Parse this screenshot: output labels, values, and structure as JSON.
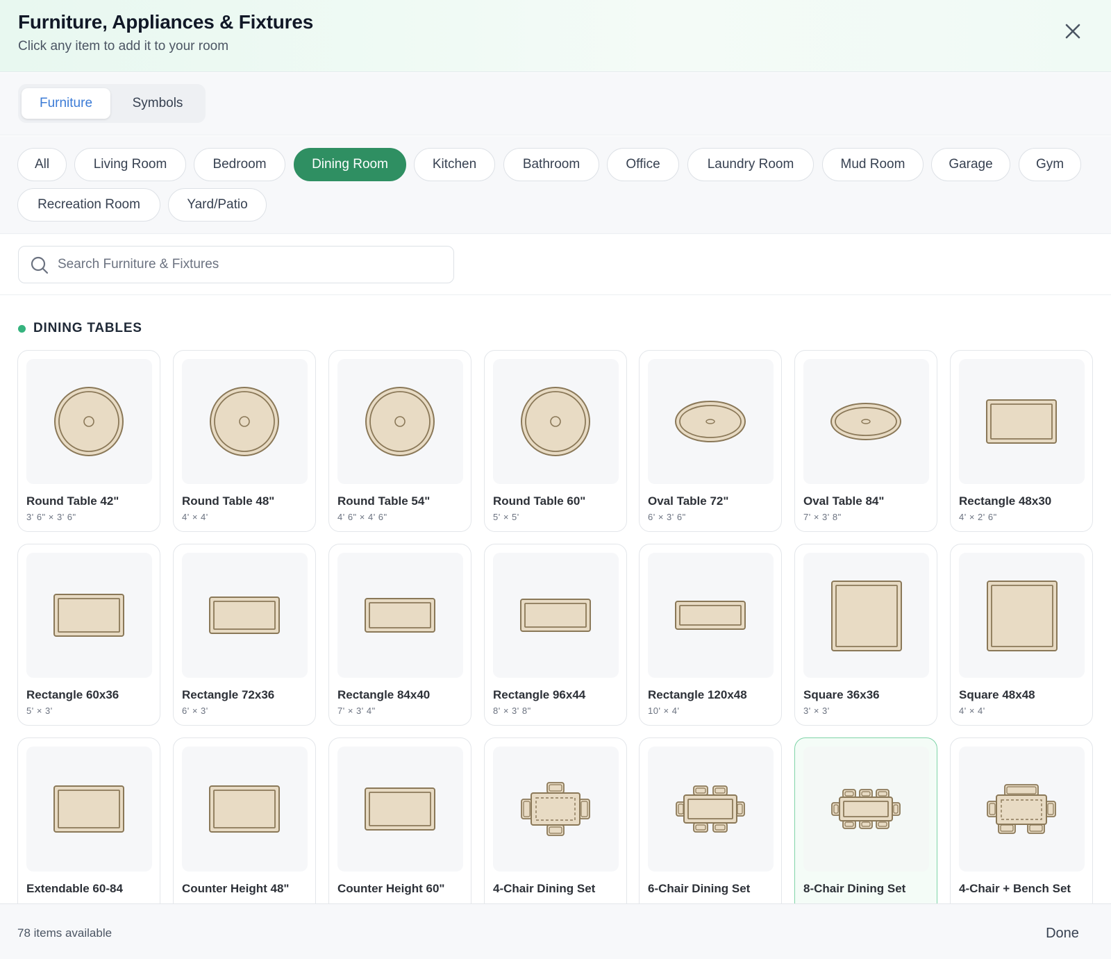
{
  "header": {
    "title": "Furniture, Appliances & Fixtures",
    "subtitle": "Click any item to add it to your room",
    "close_icon": "close-icon"
  },
  "tabs": [
    {
      "label": "Furniture",
      "active": true
    },
    {
      "label": "Symbols",
      "active": false
    }
  ],
  "categories": [
    {
      "label": "All",
      "active": false
    },
    {
      "label": "Living Room",
      "active": false
    },
    {
      "label": "Bedroom",
      "active": false
    },
    {
      "label": "Dining Room",
      "active": true
    },
    {
      "label": "Kitchen",
      "active": false
    },
    {
      "label": "Bathroom",
      "active": false
    },
    {
      "label": "Office",
      "active": false
    },
    {
      "label": "Laundry Room",
      "active": false
    },
    {
      "label": "Mud Room",
      "active": false
    },
    {
      "label": "Garage",
      "active": false
    },
    {
      "label": "Gym",
      "active": false
    },
    {
      "label": "Recreation Room",
      "active": false
    },
    {
      "label": "Yard/Patio",
      "active": false
    }
  ],
  "search": {
    "placeholder": "Search Furniture & Fixtures",
    "value": ""
  },
  "section": {
    "title": "DINING TABLES"
  },
  "items": [
    {
      "name": "Round Table 42\"",
      "dims": "3' 6\" × 3' 6\"",
      "icon": "round-table-icon"
    },
    {
      "name": "Round Table 48\"",
      "dims": "4' × 4'",
      "icon": "round-table-icon"
    },
    {
      "name": "Round Table 54\"",
      "dims": "4' 6\" × 4' 6\"",
      "icon": "round-table-icon"
    },
    {
      "name": "Round Table 60\"",
      "dims": "5' × 5'",
      "icon": "round-table-icon"
    },
    {
      "name": "Oval Table 72\"",
      "dims": "6' × 3' 6\"",
      "icon": "oval-table-icon"
    },
    {
      "name": "Oval Table 84\"",
      "dims": "7' × 3' 8\"",
      "icon": "oval-table-icon"
    },
    {
      "name": "Rectangle 48x30",
      "dims": "4' × 2' 6\"",
      "icon": "rectangle-table-icon"
    },
    {
      "name": "Rectangle 60x36",
      "dims": "5' × 3'",
      "icon": "rectangle-table-icon"
    },
    {
      "name": "Rectangle 72x36",
      "dims": "6' × 3'",
      "icon": "rectangle-table-icon"
    },
    {
      "name": "Rectangle 84x40",
      "dims": "7' × 3' 4\"",
      "icon": "rectangle-table-icon"
    },
    {
      "name": "Rectangle 96x44",
      "dims": "8' × 3' 8\"",
      "icon": "rectangle-table-icon"
    },
    {
      "name": "Rectangle 120x48",
      "dims": "10' × 4'",
      "icon": "rectangle-table-icon"
    },
    {
      "name": "Square 36x36",
      "dims": "3' × 3'",
      "icon": "square-table-icon"
    },
    {
      "name": "Square 48x48",
      "dims": "4' × 4'",
      "icon": "square-table-icon"
    },
    {
      "name": "Extendable 60-84",
      "dims": "",
      "icon": "extendable-table-icon"
    },
    {
      "name": "Counter Height 48\"",
      "dims": "",
      "icon": "counter-table-icon"
    },
    {
      "name": "Counter Height 60\"",
      "dims": "",
      "icon": "counter-table-icon"
    },
    {
      "name": "4-Chair Dining Set",
      "dims": "",
      "icon": "dining-set-4-icon"
    },
    {
      "name": "6-Chair Dining Set",
      "dims": "",
      "icon": "dining-set-6-icon"
    },
    {
      "name": "8-Chair Dining Set",
      "dims": "",
      "icon": "dining-set-8-icon",
      "highlighted": true
    },
    {
      "name": "4-Chair + Bench Set",
      "dims": "",
      "icon": "dining-set-bench-icon"
    }
  ],
  "footer": {
    "count_text": "78 items available",
    "done_label": "Done"
  },
  "colors": {
    "accent": "#2f8f62",
    "tab_active": "#3b7bd6",
    "table_fill": "#e8dbc4",
    "table_stroke": "#8a7858"
  }
}
